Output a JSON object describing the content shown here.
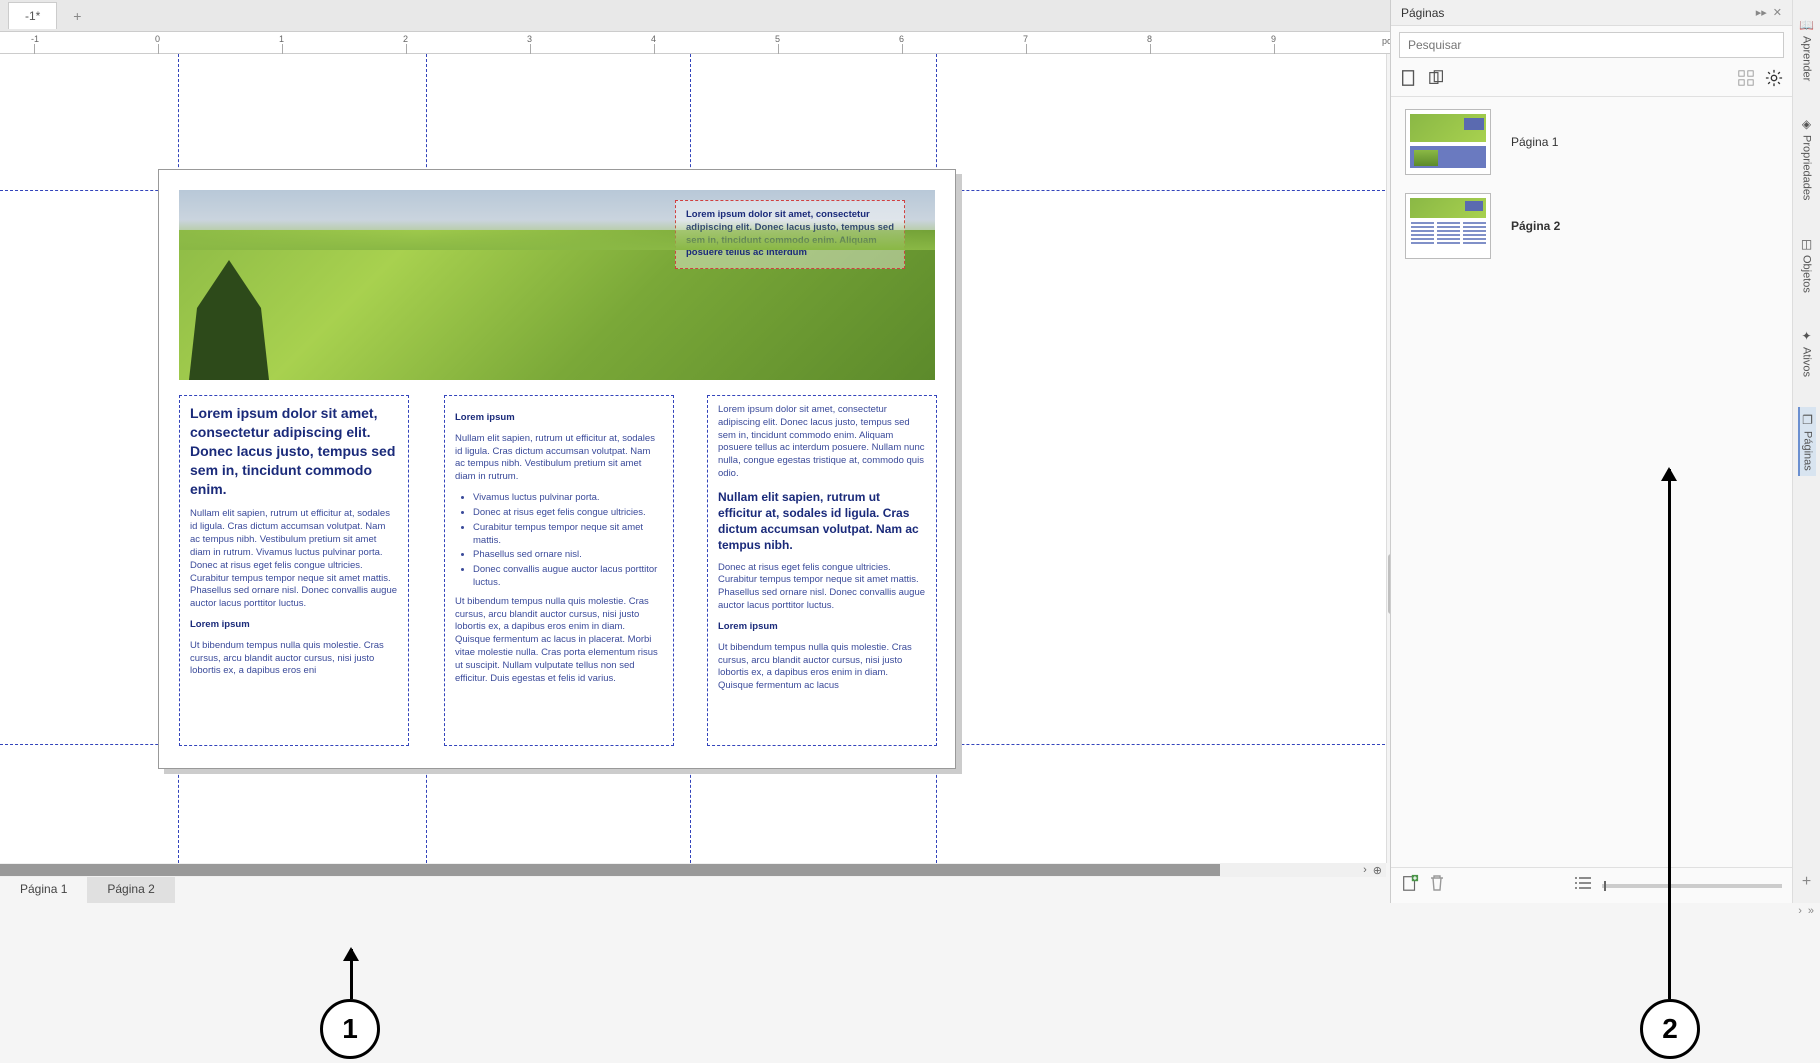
{
  "doc_tab": "-1*",
  "ruler_unit": "pol",
  "hero_note": "Lorem ipsum dolor sit amet, consectetur adipiscing elit. Donec lacus justo, tempus sed sem in, tincidunt commodo enim. Aliquam posuere tellus ac interdum",
  "col1": {
    "h1": "Lorem ipsum dolor sit amet, consectetur adipiscing elit. Donec lacus justo, tempus sed sem in, tincidunt commodo enim.",
    "p1": "Nullam elit sapien, rutrum ut efficitur at, sodales id ligula. Cras dictum accumsan volutpat. Nam ac tempus nibh. Vestibulum pretium sit amet diam in rutrum. Vivamus luctus pulvinar porta. Donec at risus eget felis congue ultricies. Curabitur tempus tempor neque sit amet mattis. Phasellus sed ornare nisl. Donec convallis augue auctor lacus porttitor luctus.",
    "h2": "Lorem ipsum",
    "p2": "Ut bibendum tempus nulla quis molestie. Cras cursus, arcu blandit auctor cursus, nisi justo lobortis ex, a dapibus eros eni"
  },
  "col2": {
    "h1": "Lorem ipsum",
    "p1": "Nullam elit sapien, rutrum ut efficitur at, sodales id ligula. Cras dictum accumsan volutpat. Nam ac tempus nibh. Vestibulum pretium sit amet diam in rutrum.",
    "b1": "Vivamus luctus pulvinar porta.",
    "b2": "Donec at risus eget felis congue ultricies.",
    "b3": "Curabitur tempus tempor neque sit amet mattis.",
    "b4": "Phasellus sed ornare nisl.",
    "b5": "Donec convallis augue auctor lacus porttitor luctus.",
    "p2": "Ut bibendum tempus nulla quis molestie. Cras cursus, arcu blandit auctor cursus, nisi justo lobortis ex, a dapibus eros enim in diam. Quisque fermentum ac lacus in placerat. Morbi vitae molestie nulla. Cras porta elementum risus ut suscipit. Nullam vulputate tellus non sed efficitur. Duis egestas et felis id varius."
  },
  "col3": {
    "p1": "Lorem ipsum dolor sit amet, consectetur adipiscing elit. Donec lacus justo, tempus sed sem in, tincidunt commodo enim. Aliquam posuere tellus ac interdum posuere. Nullam nunc nulla, congue egestas tristique at, commodo quis odio.",
    "h1": "Nullam elit sapien, rutrum ut efficitur at, sodales id ligula. Cras dictum accumsan volutpat. Nam ac tempus nibh.",
    "p2": "Donec at risus eget felis congue ultricies. Curabitur tempus tempor neque sit amet mattis. Phasellus sed ornare nisl. Donec convallis augue auctor lacus porttitor luctus.",
    "h2": "Lorem ipsum",
    "p3": "Ut bibendum tempus nulla quis molestie. Cras cursus, arcu blandit auctor cursus, nisi justo lobortis ex, a dapibus eros enim in diam. Quisque fermentum ac lacus"
  },
  "page_tabs": {
    "t1": "Página 1",
    "t2": "Página 2"
  },
  "docker": {
    "title": "Páginas",
    "search_ph": "Pesquisar",
    "page1_label": "Página 1",
    "page2_label": "Página 2"
  },
  "side_tabs": {
    "learn": "Aprender",
    "props": "Propriedades",
    "objects": "Objetos",
    "assets": "Ativos",
    "pages": "Páginas"
  },
  "annotations": {
    "a1": "1",
    "a2": "2"
  }
}
